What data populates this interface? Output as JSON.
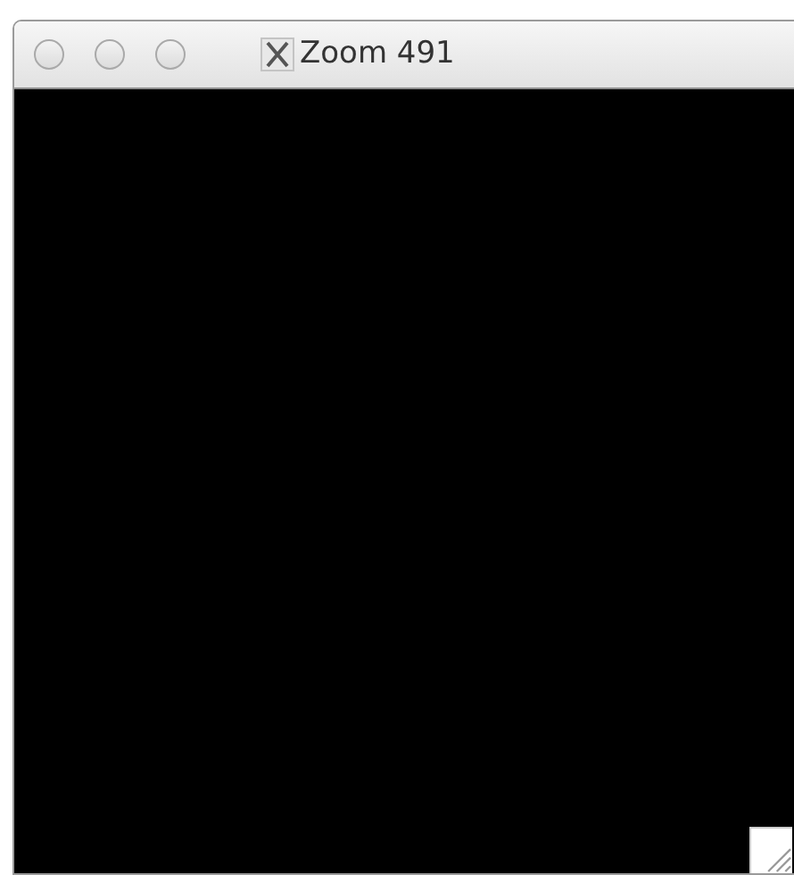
{
  "window": {
    "title": "Zoom 491",
    "active": false
  }
}
